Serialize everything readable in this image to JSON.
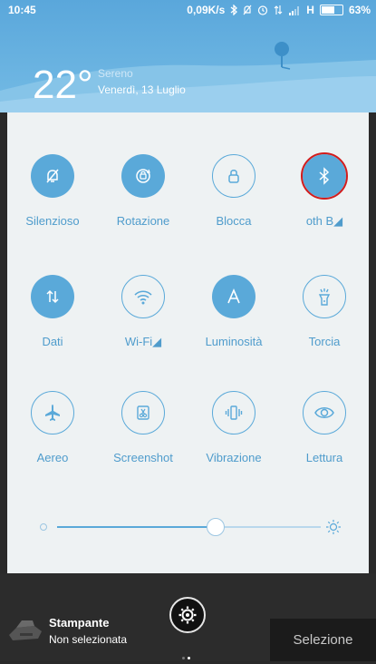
{
  "status_bar": {
    "time": "10:45",
    "speed": "0,09K/s",
    "network": "H",
    "battery": "63%",
    "battery_level": 0.63
  },
  "weather": {
    "temperature": "22°",
    "condition": "Sereno",
    "date": "Venerdì, 13 Luglio"
  },
  "toggles": [
    {
      "label": "Silenzioso",
      "icon": "bell-off-icon",
      "active": true
    },
    {
      "label": "Rotazione",
      "icon": "rotation-lock-icon",
      "active": true
    },
    {
      "label": "Blocca",
      "icon": "lock-icon",
      "active": false
    },
    {
      "label": "oth  B◢",
      "icon": "bluetooth-icon",
      "active": true
    },
    {
      "label": "Dati",
      "icon": "data-arrows-icon",
      "active": true
    },
    {
      "label": "Wi-Fi◢",
      "icon": "wifi-icon",
      "active": false
    },
    {
      "label": "Luminosità",
      "icon": "auto-brightness-icon",
      "active": true
    },
    {
      "label": "Torcia",
      "icon": "flashlight-icon",
      "active": false
    },
    {
      "label": "Aereo",
      "icon": "airplane-icon",
      "active": false
    },
    {
      "label": "Screenshot",
      "icon": "screenshot-icon",
      "active": false
    },
    {
      "label": "Vibrazione",
      "icon": "vibration-icon",
      "active": false
    },
    {
      "label": "Lettura",
      "icon": "eye-icon",
      "active": false
    }
  ],
  "brightness": {
    "level": 0.6
  },
  "bottom": {
    "printer_title": "Stampante",
    "printer_status": "Non selezionata",
    "select_label": "Selezione"
  },
  "colors": {
    "accent": "#5aa9d9",
    "panel": "#eef2f3",
    "highlight": "#d21c1c"
  }
}
